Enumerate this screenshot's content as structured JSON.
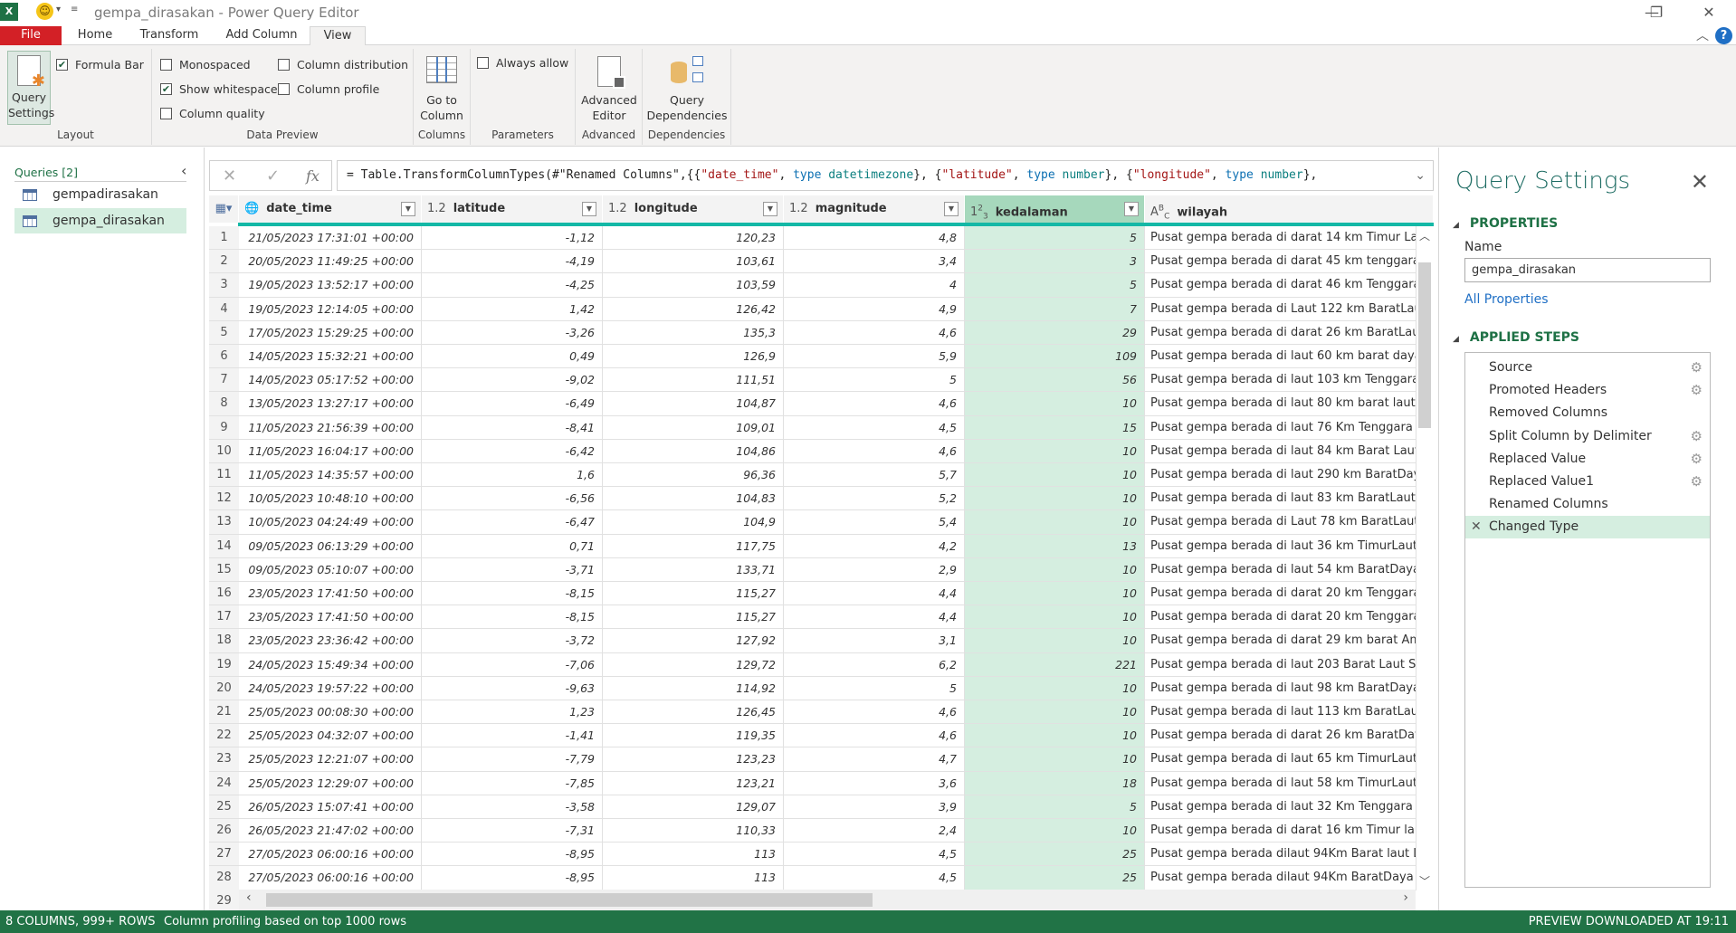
{
  "window": {
    "title": "gempa_dirasakan - Power Query Editor",
    "controls": [
      "minimize",
      "restore",
      "close"
    ]
  },
  "ribbon": {
    "tabs": [
      {
        "label": "File"
      },
      {
        "label": "Home"
      },
      {
        "label": "Transform"
      },
      {
        "label": "Add Column"
      },
      {
        "label": "View",
        "active": true
      }
    ],
    "groups": {
      "layout": {
        "label": "Layout",
        "query_settings_label": "Query Settings",
        "query_settings_line1": "Query",
        "query_settings_line2": "Settings",
        "formula_bar": {
          "label": "Formula Bar",
          "checked": true
        }
      },
      "data_preview": {
        "label": "Data Preview",
        "monospaced": {
          "label": "Monospaced",
          "checked": false
        },
        "show_whitespace": {
          "label": "Show whitespace",
          "checked": true
        },
        "column_quality": {
          "label": "Column quality",
          "checked": false
        },
        "column_distribution": {
          "label": "Column distribution",
          "checked": false
        },
        "column_profile": {
          "label": "Column profile",
          "checked": false
        }
      },
      "columns": {
        "label": "Columns",
        "go_to_line1": "Go to",
        "go_to_line2": "Column"
      },
      "parameters": {
        "label": "Parameters",
        "always_allow": {
          "label": "Always allow",
          "checked": false
        }
      },
      "advanced": {
        "label": "Advanced",
        "btn_line1": "Advanced",
        "btn_line2": "Editor"
      },
      "dependencies": {
        "label": "Dependencies",
        "btn_line1": "Query",
        "btn_line2": "Dependencies"
      }
    }
  },
  "queries": {
    "header": "Queries [2]",
    "items": [
      {
        "name": "gempadirasakan",
        "selected": false
      },
      {
        "name": "gempa_dirasakan",
        "selected": true
      }
    ]
  },
  "formula": {
    "prefix": "= Table.TransformColumnTypes(#\"Renamed Columns\",{{",
    "s1": "\"date_time\"",
    "sep1": ", ",
    "k1": "type",
    "t1": " datetimezone",
    "c1": "}, {",
    "s2": "\"latitude\"",
    "sep2": ", ",
    "k2": "type",
    "t2": " number",
    "c2": "}, {",
    "s3": "\"longitude\"",
    "sep3": ", ",
    "k3": "type",
    "t3": " number",
    "c3": "},"
  },
  "table": {
    "columns": [
      {
        "name": "date_time",
        "type_icon": "datetimezone-icon"
      },
      {
        "name": "latitude",
        "type_icon": "1.2"
      },
      {
        "name": "longitude",
        "type_icon": "1.2"
      },
      {
        "name": "magnitude",
        "type_icon": "1.2"
      },
      {
        "name": "kedalaman",
        "type_icon": "123",
        "selected": true
      },
      {
        "name": "wilayah",
        "type_icon": "ABC"
      }
    ],
    "rows": [
      {
        "n": "1",
        "date_time": "21/05/2023 17:31:01 +00:00",
        "latitude": "-1,12",
        "longitude": "120,23",
        "magnitude": "4,8",
        "kedalaman": "5",
        "wilayah": "Pusat gempa berada di darat 14 km Timur Laut K"
      },
      {
        "n": "2",
        "date_time": "20/05/2023 11:49:25 +00:00",
        "latitude": "-4,19",
        "longitude": "103,61",
        "magnitude": "3,4",
        "kedalaman": "3",
        "wilayah": "Pusat gempa berada di darat 45 km tenggara Lah"
      },
      {
        "n": "3",
        "date_time": "19/05/2023 13:52:17 +00:00",
        "latitude": "-4,25",
        "longitude": "103,59",
        "magnitude": "4",
        "kedalaman": "5",
        "wilayah": "Pusat gempa berada di darat 46 km Tenggara Pa"
      },
      {
        "n": "4",
        "date_time": "19/05/2023 12:14:05 +00:00",
        "latitude": "1,42",
        "longitude": "126,42",
        "magnitude": "4,9",
        "kedalaman": "7",
        "wilayah": "Pusat gempa berada di Laut 122 km BaratLaut Ja"
      },
      {
        "n": "5",
        "date_time": "17/05/2023 15:29:25 +00:00",
        "latitude": "-3,26",
        "longitude": "135,3",
        "magnitude": "4,6",
        "kedalaman": "29",
        "wilayah": "Pusat gempa berada di darat 26 km BaratLaut N"
      },
      {
        "n": "6",
        "date_time": "14/05/2023 15:32:21 +00:00",
        "latitude": "0,49",
        "longitude": "126,9",
        "magnitude": "5,9",
        "kedalaman": "109",
        "wilayah": "Pusat gempa berada di laut 60 km barat daya Te"
      },
      {
        "n": "7",
        "date_time": "14/05/2023 05:17:52 +00:00",
        "latitude": "-9,02",
        "longitude": "111,51",
        "magnitude": "5",
        "kedalaman": "56",
        "wilayah": "Pusat gempa berada di laut 103 km Tenggara Pa"
      },
      {
        "n": "8",
        "date_time": "13/05/2023 13:27:17 +00:00",
        "latitude": "-6,49",
        "longitude": "104,87",
        "magnitude": "4,6",
        "kedalaman": "10",
        "wilayah": "Pusat gempa berada di laut 80 km barat laut Sur"
      },
      {
        "n": "9",
        "date_time": "11/05/2023 21:56:39 +00:00",
        "latitude": "-8,41",
        "longitude": "109,01",
        "magnitude": "4,5",
        "kedalaman": "15",
        "wilayah": "Pusat gempa berada di laut 76 Km Tenggara Cila"
      },
      {
        "n": "10",
        "date_time": "11/05/2023 16:04:17 +00:00",
        "latitude": "-6,42",
        "longitude": "104,86",
        "magnitude": "4,6",
        "kedalaman": "10",
        "wilayah": "Pusat gempa berada di laut 84 km Barat Laut SU"
      },
      {
        "n": "11",
        "date_time": "11/05/2023 14:35:57 +00:00",
        "latitude": "1,6",
        "longitude": "96,36",
        "magnitude": "5,7",
        "kedalaman": "10",
        "wilayah": "Pusat gempa berada di laut 290 km BaratDaya G"
      },
      {
        "n": "12",
        "date_time": "10/05/2023 10:48:10 +00:00",
        "latitude": "-6,56",
        "longitude": "104,83",
        "magnitude": "5,2",
        "kedalaman": "10",
        "wilayah": "Pusat gempa berada di laut 83 km BaratLaut Sur"
      },
      {
        "n": "13",
        "date_time": "10/05/2023 04:24:49 +00:00",
        "latitude": "-6,47",
        "longitude": "104,9",
        "magnitude": "5,4",
        "kedalaman": "10",
        "wilayah": "Pusat gempa berada di Laut 78 km BaratLaut Su"
      },
      {
        "n": "14",
        "date_time": "09/05/2023 06:13:29 +00:00",
        "latitude": "0,71",
        "longitude": "117,75",
        "magnitude": "4,2",
        "kedalaman": "13",
        "wilayah": "Pusat gempa berada di laut 36 km TimurLaut Sa"
      },
      {
        "n": "15",
        "date_time": "09/05/2023 05:10:07 +00:00",
        "latitude": "-3,71",
        "longitude": "133,71",
        "magnitude": "2,9",
        "kedalaman": "10",
        "wilayah": "Pusat gempa berada di laut 54 km BaratDaya Ka"
      },
      {
        "n": "16",
        "date_time": "23/05/2023 17:41:50 +00:00",
        "latitude": "-8,15",
        "longitude": "115,27",
        "magnitude": "4,4",
        "kedalaman": "10",
        "wilayah": "Pusat gempa berada di darat 20 km Tenggara Bu"
      },
      {
        "n": "17",
        "date_time": "23/05/2023 17:41:50 +00:00",
        "latitude": "-8,15",
        "longitude": "115,27",
        "magnitude": "4,4",
        "kedalaman": "10",
        "wilayah": "Pusat gempa berada di darat 20 km Tenggara Bu"
      },
      {
        "n": "18",
        "date_time": "23/05/2023 23:36:42 +00:00",
        "latitude": "-3,72",
        "longitude": "127,92",
        "magnitude": "3,1",
        "kedalaman": "10",
        "wilayah": "Pusat gempa berada di darat 29 km barat Ambo"
      },
      {
        "n": "19",
        "date_time": "24/05/2023 15:49:34 +00:00",
        "latitude": "-7,06",
        "longitude": "129,72",
        "magnitude": "6,2",
        "kedalaman": "221",
        "wilayah": "Pusat gempa berada di laut 203 Barat Laut Saum"
      },
      {
        "n": "20",
        "date_time": "24/05/2023 19:57:22 +00:00",
        "latitude": "-9,63",
        "longitude": "114,92",
        "magnitude": "5",
        "kedalaman": "10",
        "wilayah": "Pusat gempa berada di laut 98 km BaratDaya KU"
      },
      {
        "n": "21",
        "date_time": "25/05/2023 00:08:30 +00:00",
        "latitude": "1,23",
        "longitude": "126,45",
        "magnitude": "4,6",
        "kedalaman": "10",
        "wilayah": "Pusat gempa berada di laut 113 km BaratLaut Te"
      },
      {
        "n": "22",
        "date_time": "25/05/2023 04:32:07 +00:00",
        "latitude": "-1,41",
        "longitude": "119,35",
        "magnitude": "4,6",
        "kedalaman": "10",
        "wilayah": "Pusat gempa berada di darat 26 km BaratDaya P"
      },
      {
        "n": "23",
        "date_time": "25/05/2023 12:21:07 +00:00",
        "latitude": "-7,79",
        "longitude": "123,23",
        "magnitude": "4,7",
        "kedalaman": "10",
        "wilayah": "Pusat gempa berada di laut 65 km TimurLaut LA"
      },
      {
        "n": "24",
        "date_time": "25/05/2023 12:29:07 +00:00",
        "latitude": "-7,85",
        "longitude": "123,21",
        "magnitude": "3,6",
        "kedalaman": "18",
        "wilayah": "Pusat gempa berada di laut 58 km TimurLaut Lar"
      },
      {
        "n": "25",
        "date_time": "26/05/2023 15:07:41 +00:00",
        "latitude": "-3,58",
        "longitude": "129,07",
        "magnitude": "3,9",
        "kedalaman": "5",
        "wilayah": "Pusat gempa berada di laut 32 Km Tenggara Ma"
      },
      {
        "n": "26",
        "date_time": "26/05/2023 21:47:02 +00:00",
        "latitude": "-7,31",
        "longitude": "110,33",
        "magnitude": "2,4",
        "kedalaman": "10",
        "wilayah": "Pusat gempa berada di darat 16 km Timur laut T"
      },
      {
        "n": "27",
        "date_time": "27/05/2023 06:00:16 +00:00",
        "latitude": "-8,95",
        "longitude": "113",
        "magnitude": "4,5",
        "kedalaman": "25",
        "wilayah": "Pusat gempa berada dilaut 94Km Barat laut Lum"
      },
      {
        "n": "28",
        "date_time": "27/05/2023 06:00:16 +00:00",
        "latitude": "-8,95",
        "longitude": "113",
        "magnitude": "4,5",
        "kedalaman": "25",
        "wilayah": "Pusat gempa berada dilaut 94Km BaratDaya Lun"
      }
    ],
    "next_row_number": "29"
  },
  "query_settings": {
    "title": "Query Settings",
    "properties_header": "PROPERTIES",
    "name_label": "Name",
    "name_value": "gempa_dirasakan",
    "all_properties": "All Properties",
    "applied_steps_header": "APPLIED STEPS",
    "steps": [
      {
        "label": "Source",
        "gear": true
      },
      {
        "label": "Promoted Headers",
        "gear": true
      },
      {
        "label": "Removed Columns",
        "gear": false
      },
      {
        "label": "Split Column by Delimiter",
        "gear": true
      },
      {
        "label": "Replaced Value",
        "gear": true
      },
      {
        "label": "Replaced Value1",
        "gear": true
      },
      {
        "label": "Renamed Columns",
        "gear": false
      },
      {
        "label": "Changed Type",
        "gear": false,
        "selected": true
      }
    ]
  },
  "status": {
    "columns_rows": "8 COLUMNS, 999+ ROWS",
    "profiling": "Column profiling based on top 1000 rows",
    "preview": "PREVIEW DOWNLOADED AT 19:11"
  },
  "colors": {
    "accent_green": "#217346",
    "selection_green": "#d5eee0",
    "teal_quality": "#14b8a6",
    "file_tab_red": "#d32026"
  }
}
